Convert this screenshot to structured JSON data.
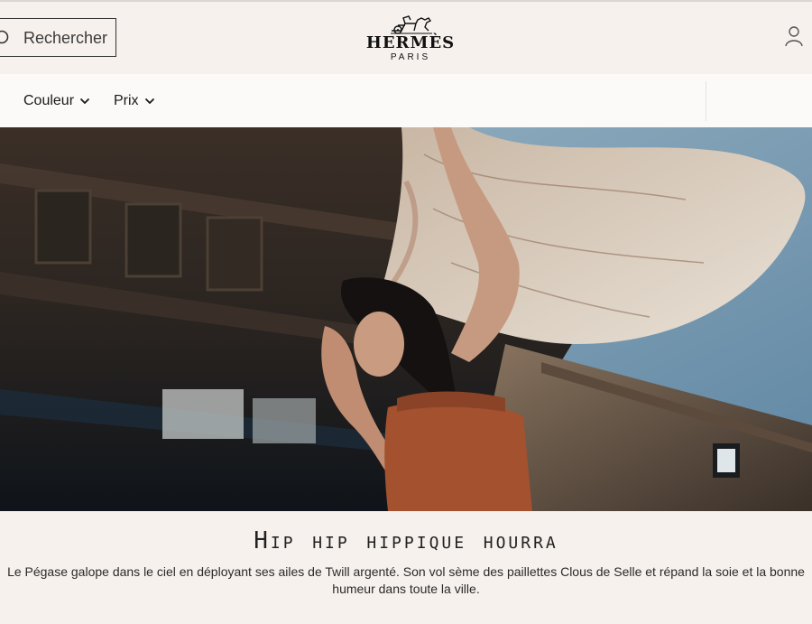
{
  "header": {
    "search_label": "Rechercher",
    "logo_brand": "HERMÈS",
    "logo_city": "PARIS",
    "icons": {
      "search": "search-icon",
      "account": "user-icon",
      "logo_emblem": "carriage-logo-icon"
    }
  },
  "filters": {
    "items": [
      {
        "label": "Couleur",
        "icon": "chevron-down-icon"
      },
      {
        "label": "Prix",
        "icon": "chevron-down-icon"
      }
    ]
  },
  "hero": {
    "image": "woman-with-silk-scarf-photo"
  },
  "caption": {
    "title": "Hip hip hippique hourra",
    "text": "Le Pégase galope dans le ciel en déployant ses ailes de Twill argenté. Son vol sème des paillettes Clous de Selle et répand la soie et la bonne humeur dans toute la ville."
  },
  "colors": {
    "background": "#f6f1ed",
    "filter_bar": "#fcfaf8",
    "text": "#1a1a1a"
  }
}
